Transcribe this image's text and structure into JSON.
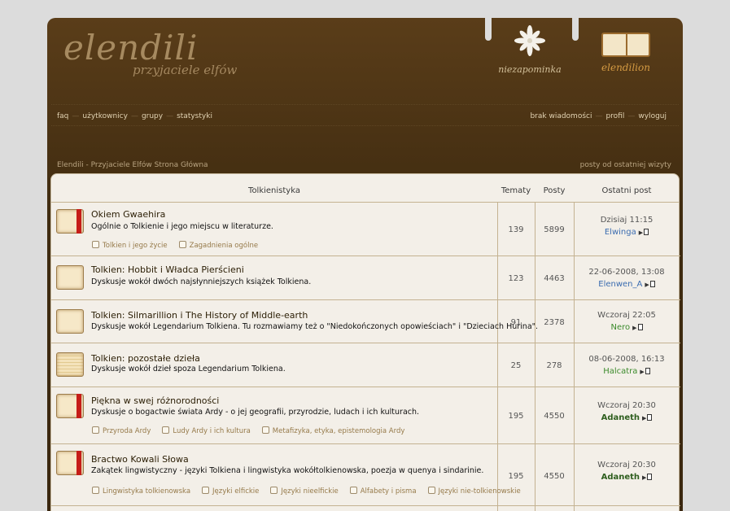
{
  "logo": {
    "title": "elendili",
    "subtitle": "przyjaciele elfów"
  },
  "tabs": {
    "flower_label": "niezapominka",
    "book_label": "elendilion"
  },
  "nav": {
    "left": [
      "faq",
      "użytkownicy",
      "grupy",
      "statystyki"
    ],
    "right": [
      "brak wiadomości",
      "profil",
      "wyloguj"
    ]
  },
  "breadcrumb": "Elendili - Przyjaciele Elfów Strona Główna",
  "since_last_visit": "posty od ostatniej wizyty",
  "table": {
    "category": "Tolkienistyka",
    "col_topics": "Tematy",
    "col_posts": "Posty",
    "col_last": "Ostatni post"
  },
  "forums": [
    {
      "title": "Okiem Gwaehira",
      "desc": "Ogólnie o Tolkienie i jego miejscu w literaturze.",
      "subs": [
        "Tolkien i jego życie",
        "Zagadnienia ogólne"
      ],
      "topics": "139",
      "posts": "5899",
      "last_date": "Dzisiaj 11:15",
      "last_user": "Elwinga",
      "user_color": "#3b6cb0"
    },
    {
      "title": "Tolkien: Hobbit i Władca Pierścieni",
      "desc": "Dyskusje wokół dwóch najsłynniejszych książek Tolkiena.",
      "subs": [],
      "topics": "123",
      "posts": "4463",
      "last_date": "22-06-2008, 13:08",
      "last_user": "Elenwen_A",
      "user_color": "#3b6cb0"
    },
    {
      "title": "Tolkien: Silmarillion i The History of Middle-earth",
      "desc": "Dyskusje wokół Legendarium Tolkiena. Tu rozmawiamy też o \"Niedokończonych opowieściach\" i \"Dzieciach Húrina\".",
      "subs": [],
      "topics": "91",
      "posts": "2378",
      "last_date": "Wczoraj 22:05",
      "last_user": "Nero",
      "user_color": "#3c8b2c"
    },
    {
      "title": "Tolkien: pozostałe dzieła",
      "desc": "Dyskusje wokół dzieł spoza Legendarium Tolkiena.",
      "subs": [],
      "topics": "25",
      "posts": "278",
      "last_date": "08-06-2008, 16:13",
      "last_user": "Halcatra",
      "user_color": "#3c8b2c"
    },
    {
      "title": "Piękna w swej różnorodności",
      "desc": "Dyskusje o bogactwie świata Ardy - o jej geografii, przyrodzie, ludach i ich kulturach.",
      "subs": [
        "Przyroda Ardy",
        "Ludy Ardy i ich kultura",
        "Metafizyka, etyka, epistemologia Ardy"
      ],
      "topics": "195",
      "posts": "4550",
      "last_date": "Wczoraj 20:30",
      "last_user": "Adaneth",
      "user_color": "#2e5e1e"
    },
    {
      "title": "Bractwo Kowali Słowa",
      "desc": "Zakątek lingwistyczny - języki Tolkiena i lingwistyka wokółtolkienowska, poezja w quenya i sindarinie.",
      "subs": [
        "Lingwistyka tolkienowska",
        "Języki elfickie",
        "Języki nieelfickie",
        "Alfabety i pisma",
        "Języki nie-tolkienowskie"
      ],
      "topics": "195",
      "posts": "4550",
      "last_date": "Wczoraj 20:30",
      "last_user": "Adaneth",
      "user_color": "#2e5e1e"
    }
  ]
}
